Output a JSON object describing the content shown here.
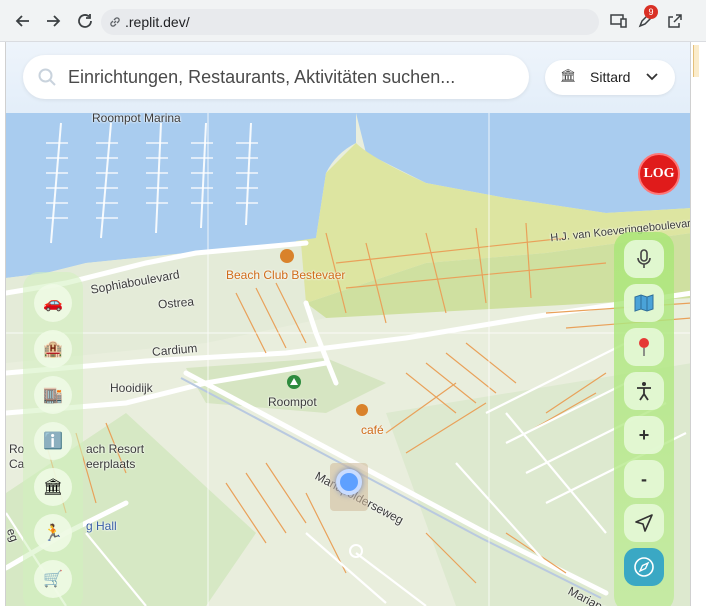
{
  "browser": {
    "url": ".replit.dev/",
    "badge_count": "9"
  },
  "search": {
    "placeholder": "Einrichtungen, Restaurants, Aktivitäten suchen..."
  },
  "city_select": {
    "value": "Sittard",
    "icon": "museum-icon"
  },
  "log_button": {
    "label": "LOG",
    "color": "#e01b1b"
  },
  "map": {
    "labels": {
      "marina": "Roompot Marina",
      "beach_club": "Beach Club Bestevaer",
      "sophiaboulevard": "Sophiaboulevard",
      "ostrea": "Ostrea",
      "cardium": "Cardium",
      "hooidijk": "Hooidijk",
      "roompot": "Roompot",
      "cafe": "café",
      "resort": "Roompot Beach Resort",
      "resort_partial_1": "Ro",
      "resort_partial_2": "ach Resort",
      "kamperplaats_1": "Ca",
      "kamperplaats_2": "eerplaats",
      "hall": "g Hall",
      "mariapolderseweg": "Mariapolderseweg",
      "mariapo": "Mariapo",
      "koeveringe": "H.J. van Koeveringeboulevar",
      "weg_partial": "eg"
    }
  },
  "left_toolbar": {
    "items": [
      {
        "icon": "car-icon"
      },
      {
        "icon": "hotel-icon"
      },
      {
        "icon": "building-icon"
      },
      {
        "icon": "info-icon"
      },
      {
        "icon": "museum-icon"
      },
      {
        "icon": "sport-icon"
      },
      {
        "icon": "shopping-cart-icon"
      }
    ]
  },
  "right_toolbar": {
    "zoom_in_label": "+",
    "zoom_out_label": "-",
    "items": [
      {
        "icon": "microphone-icon"
      },
      {
        "icon": "map-icon"
      },
      {
        "icon": "pin-icon"
      },
      {
        "icon": "accessibility-icon"
      },
      {
        "icon": "zoom-in-icon"
      },
      {
        "icon": "zoom-out-icon"
      },
      {
        "icon": "navigate-icon"
      },
      {
        "icon": "compass-icon"
      }
    ],
    "accent_color": "#3aa8c4"
  }
}
